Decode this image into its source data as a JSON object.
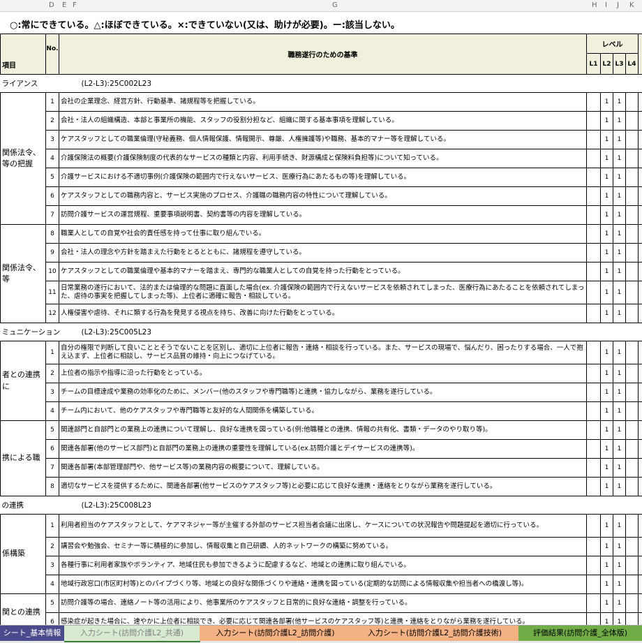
{
  "column_headers": [
    "D",
    "E",
    "F",
    "G",
    "H",
    "I",
    "J",
    "K"
  ],
  "legend": "○:常にできている。△:ほぼできている。×:できていない(又は、助けが必要)。ー:該当しない。",
  "header": {
    "item": "項目",
    "no": "No.",
    "criteria": "職務遂行のための基準",
    "level": "レベル",
    "levels": [
      "L1",
      "L2",
      "L3",
      "L4"
    ]
  },
  "sections": [
    {
      "name": "ライアンス",
      "code": "(L2-L3):25C002L23",
      "groups": [
        {
          "label": "関係法令、\n等の把握",
          "rows": [
            {
              "no": "1",
              "text": "会社の企業理念、経営方針、行動基準、諸規程等を把握している。",
              "l2": "1",
              "l3": "1"
            },
            {
              "no": "2",
              "text": "会社・法人の組織構造、本部と事業所の機能、スタッフの役割分担など、組織に関する基本事項を理解している。",
              "l2": "1",
              "l3": "1"
            },
            {
              "no": "3",
              "text": "ケアスタッフとしての職業倫理(守秘義務、個人情報保護、情報開示、尊厳、人権擁護等)や職務、基本的マナー等を理解している。",
              "l2": "1",
              "l3": "1"
            },
            {
              "no": "4",
              "text": "介護保険法の概要(介護保険制度の代表的なサービスの種類と内容、利用手続き、財源構成と保険料負担等)について知っている。",
              "l2": "1",
              "l3": "1"
            },
            {
              "no": "5",
              "text": "介護サービスにおける不適切事例(介護保険の範囲内で行えないサービス、医療行為にあたるもの等)を理解している。",
              "l2": "1",
              "l3": "1"
            },
            {
              "no": "6",
              "text": "ケアスタッフとしての職務内容と、サービス実施のプロセス、介護職の職務内容の特性について理解している。",
              "l2": "1",
              "l3": "1"
            },
            {
              "no": "7",
              "text": "訪問介護サービスの運営規程、重要事項説明書、契約書等の内容を理解している。",
              "l2": "1",
              "l3": "1"
            }
          ]
        },
        {
          "label": "関係法令、\n等",
          "rows": [
            {
              "no": "8",
              "text": "職業人としての自覚や社会的責任感を持って仕事に取り組んでいる。",
              "l2": "1",
              "l3": "1"
            },
            {
              "no": "9",
              "text": "会社・法人の理念や方針を踏まえた行動をとるとともに、諸規程を遵守している。",
              "l2": "1",
              "l3": "1"
            },
            {
              "no": "10",
              "text": "ケアスタッフとしての職業倫理や基本的マナーを踏まえ、専門的な職業人としての自覚を持った行動をとっている。",
              "l2": "1",
              "l3": "1"
            },
            {
              "no": "11",
              "text": "日常業務の遂行において、法的または倫理的な問題に直面した場合(ex. 介護保険の範囲内で行えないサービスを依頼されてしまった、医療行為にあたることを依頼されてしまった、虐待の事実を把握してしまった等)、上位者に適確に報告・相談している。",
              "l2": "1",
              "l3": "1",
              "tall": true
            },
            {
              "no": "12",
              "text": "人権侵害や虐待、それに類する行為を発見する視点を持ち、改善に向けた行動をとっている。",
              "l2": "1",
              "l3": "1"
            }
          ]
        }
      ]
    },
    {
      "name": "ミュニケーション",
      "code": "(L2-L3):25C005L23",
      "groups": [
        {
          "label": "者との連携に",
          "rows": [
            {
              "no": "1",
              "text": "自分の権限で判断して良いこととそうでないことを区別し、適切に上位者に報告・連絡・相談を行っている。また、サービスの現場で、悩んだり、困ったりする場合、一人で抱え込まず、上位者に相談し、サービス品質の維持・向上につなげている。",
              "l2": "1",
              "l3": "1",
              "tall": true
            },
            {
              "no": "2",
              "text": "上位者の指示や指導に沿った行動をとっている。",
              "l2": "1",
              "l3": "1"
            },
            {
              "no": "3",
              "text": "チームの目標達成や業務の効率化のために、メンバー(他のスタッフや専門職等)と連携・協力しながら、業務を遂行している。",
              "l2": "1",
              "l3": "1"
            },
            {
              "no": "4",
              "text": "チーム内において、他のケアスタッフや専門職等と友好的な人間関係を構築している。",
              "l2": "1",
              "l3": "1"
            }
          ]
        },
        {
          "label": "携による職",
          "rows": [
            {
              "no": "5",
              "text": "関連部門と自部門との業務上の連携について理解し、良好な連携を図っている(例:他職種との連携、情報の共有化、書類・データのやり取り等)。",
              "l2": "1",
              "l3": "1"
            },
            {
              "no": "6",
              "text": "関連各部署(他のサービス部門)と自部門の業務上の連携の重要性を理解している(ex.訪問介護とデイサービスの連携等)。",
              "l2": "1",
              "l3": "1"
            },
            {
              "no": "7",
              "text": "関連各部署(本部管理部門や、他サービス等)の業務内容の概要について、理解している。",
              "l2": "1",
              "l3": "1"
            },
            {
              "no": "8",
              "text": "適切なサービスを提供するために、関連各部署(他サービスのケアスタッフ等)と必要に応じて良好な連携・連絡をとりながら業務を遂行している。",
              "l2": "1",
              "l3": "1"
            }
          ]
        }
      ]
    },
    {
      "name": "の連携",
      "code": "(L2-L3):25C008L23",
      "groups": [
        {
          "label": "係構築",
          "rows": [
            {
              "no": "1",
              "text": "利用者担当のケアスタッフとして、ケアマネジャー等が主催する外部のサービス担当者会議に出席し、ケースについての状況報告や問題提起を適切に行っている。",
              "l2": "1",
              "l3": "1",
              "tall": true
            },
            {
              "no": "2",
              "text": "講習会や勉強会、セミナー等に積極的に参加し、情報収集と自己研鑽、人的ネットワークの構築に努めている。",
              "l2": "1",
              "l3": "1"
            },
            {
              "no": "3",
              "text": "各種行事に利用者家族やボランティア、地域住民も参加できるように配慮するなど、地域との連携に取り組んでいる。",
              "l2": "1",
              "l3": "1"
            },
            {
              "no": "4",
              "text": "地域行政窓口(市区町村等)とのパイプづくり等、地域との良好な関係づくりや連絡・連携を図っている(定期的な訪問による情報収集や担当者への橋渡し等)。",
              "l2": "1",
              "l3": "1"
            }
          ]
        },
        {
          "label": "関との連携",
          "rows": [
            {
              "no": "5",
              "text": "訪問介護等の場合、連絡ノート等の活用により、他事業所のケアスタッフと日常的に良好な連絡・調整を行っている。",
              "l2": "1",
              "l3": "1"
            },
            {
              "no": "6",
              "text": "感染症が起きた場合に、速やかに上位者に相談でき、必要に応じて関連各部署(他サービスのケアスタッフ等)と連携・連絡をとりながら業務を遂行している。",
              "l2": "1",
              "l3": "1"
            }
          ]
        }
      ]
    }
  ],
  "tabs": [
    {
      "label": "シート_基本情報",
      "bg": "#4a4a8c",
      "fg": "#ffffff"
    },
    {
      "label": "入力シート(訪問介護L2_共通)",
      "bg": "#d9ead3",
      "fg": "#7f7f7f"
    },
    {
      "label": "入力シート(訪問介護L2_訪問介護)",
      "bg": "#f4b183",
      "fg": "#000000"
    },
    {
      "label": "入力シート(訪問介護L2_訪問介護技術)",
      "bg": "#f4b183",
      "fg": "#000000"
    },
    {
      "label": "評価結果(訪問介護_全体版)",
      "bg": "#70ad47",
      "fg": "#000000"
    }
  ]
}
